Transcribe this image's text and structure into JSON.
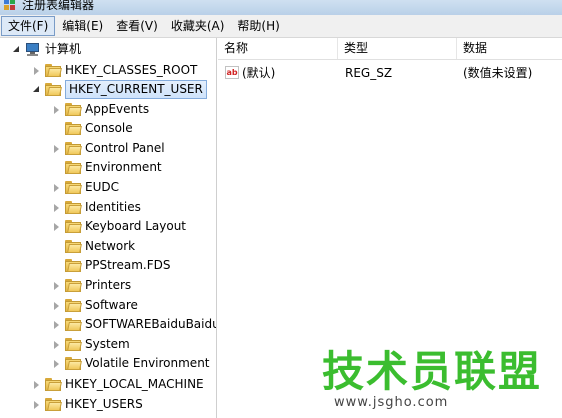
{
  "window": {
    "title": "注册表编辑器",
    "icon": "regedit-icon"
  },
  "menubar": {
    "items": [
      "文件(F)",
      "编辑(E)",
      "查看(V)",
      "收藏夹(A)",
      "帮助(H)"
    ]
  },
  "tree": {
    "root": "计算机",
    "hives": {
      "classes_root": "HKEY_CLASSES_ROOT",
      "current_user": "HKEY_CURRENT_USER",
      "local_machine": "HKEY_LOCAL_MACHINE",
      "users": "HKEY_USERS"
    },
    "current_user_children": [
      "AppEvents",
      "Console",
      "Control Panel",
      "Environment",
      "EUDC",
      "Identities",
      "Keyboard Layout",
      "Network",
      "PPStream.FDS",
      "Printers",
      "Software",
      "SOFTWAREBaiduBaidu",
      "System",
      "Volatile Environment"
    ]
  },
  "list": {
    "columns": {
      "name": "名称",
      "type": "类型",
      "data": "数据"
    },
    "rows": [
      {
        "name": "(默认)",
        "type": "REG_SZ",
        "data": "(数值未设置)",
        "icon": "string-value-icon"
      }
    ]
  },
  "watermark": {
    "brand": "技术员联盟",
    "url": "www.jsgho.com",
    "color": "#3bbd2f"
  }
}
